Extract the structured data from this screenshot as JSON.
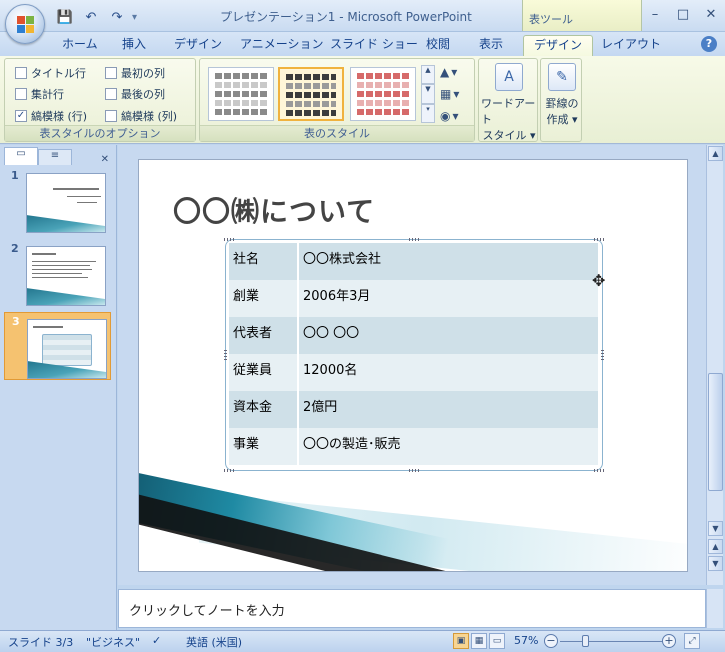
{
  "window": {
    "title": "プレゼンテーション1 - Microsoft PowerPoint",
    "context_tool": "表ツール",
    "minimize": "–",
    "maximize": "□",
    "close": "✕"
  },
  "qat": {
    "save_icon": "save-icon",
    "undo_icon": "undo-icon",
    "redo_icon": "redo-icon",
    "customize": "▾"
  },
  "ribbon_tabs": [
    "ホーム",
    "挿入",
    "デザイン",
    "アニメーション",
    "スライド ショー",
    "校閲",
    "表示",
    "デザイン",
    "レイアウト"
  ],
  "active_tab_index": 7,
  "table_style_options": {
    "label": "表スタイルのオプション",
    "options": [
      {
        "label": "タイトル行",
        "checked": false
      },
      {
        "label": "最初の列",
        "checked": false
      },
      {
        "label": "集計行",
        "checked": false
      },
      {
        "label": "最後の列",
        "checked": false
      },
      {
        "label": "縞模様 (行)",
        "checked": true
      },
      {
        "label": "縞模様 (列)",
        "checked": false
      }
    ]
  },
  "table_styles": {
    "label": "表のスタイル",
    "thumb_colors": [
      "#c9c9c9",
      "#3c3c3c",
      "#e8a0a0"
    ],
    "selected_index": 1
  },
  "wordart": {
    "label": "ワードアート",
    "label2": "スタイル ▾"
  },
  "borders": {
    "label": "罫線の",
    "label2": "作成 ▾"
  },
  "slides_pane": {
    "slides": [
      {
        "num": "1",
        "title": "〇〇株のIE T導入"
      },
      {
        "num": "2",
        "title": "本題の概要"
      },
      {
        "num": "3",
        "title": "〇〇株について"
      }
    ],
    "active_index": 2
  },
  "slide": {
    "title": "〇〇㈱について",
    "table": [
      {
        "key": "社名",
        "value": "〇〇株式会社"
      },
      {
        "key": "創業",
        "value": "2006年3月"
      },
      {
        "key": "代表者",
        "value": "〇〇 〇〇"
      },
      {
        "key": "従業員",
        "value": "12000名"
      },
      {
        "key": "資本金",
        "value": "2億円"
      },
      {
        "key": "事業",
        "value": "〇〇の製造･販売"
      }
    ]
  },
  "notes": {
    "placeholder": "クリックしてノートを入力"
  },
  "status": {
    "slide_info": "スライド 3/3",
    "theme": "\"ビジネス\"",
    "language": "英語 (米国)",
    "zoom": "57%",
    "zoom_level": 0.57
  }
}
